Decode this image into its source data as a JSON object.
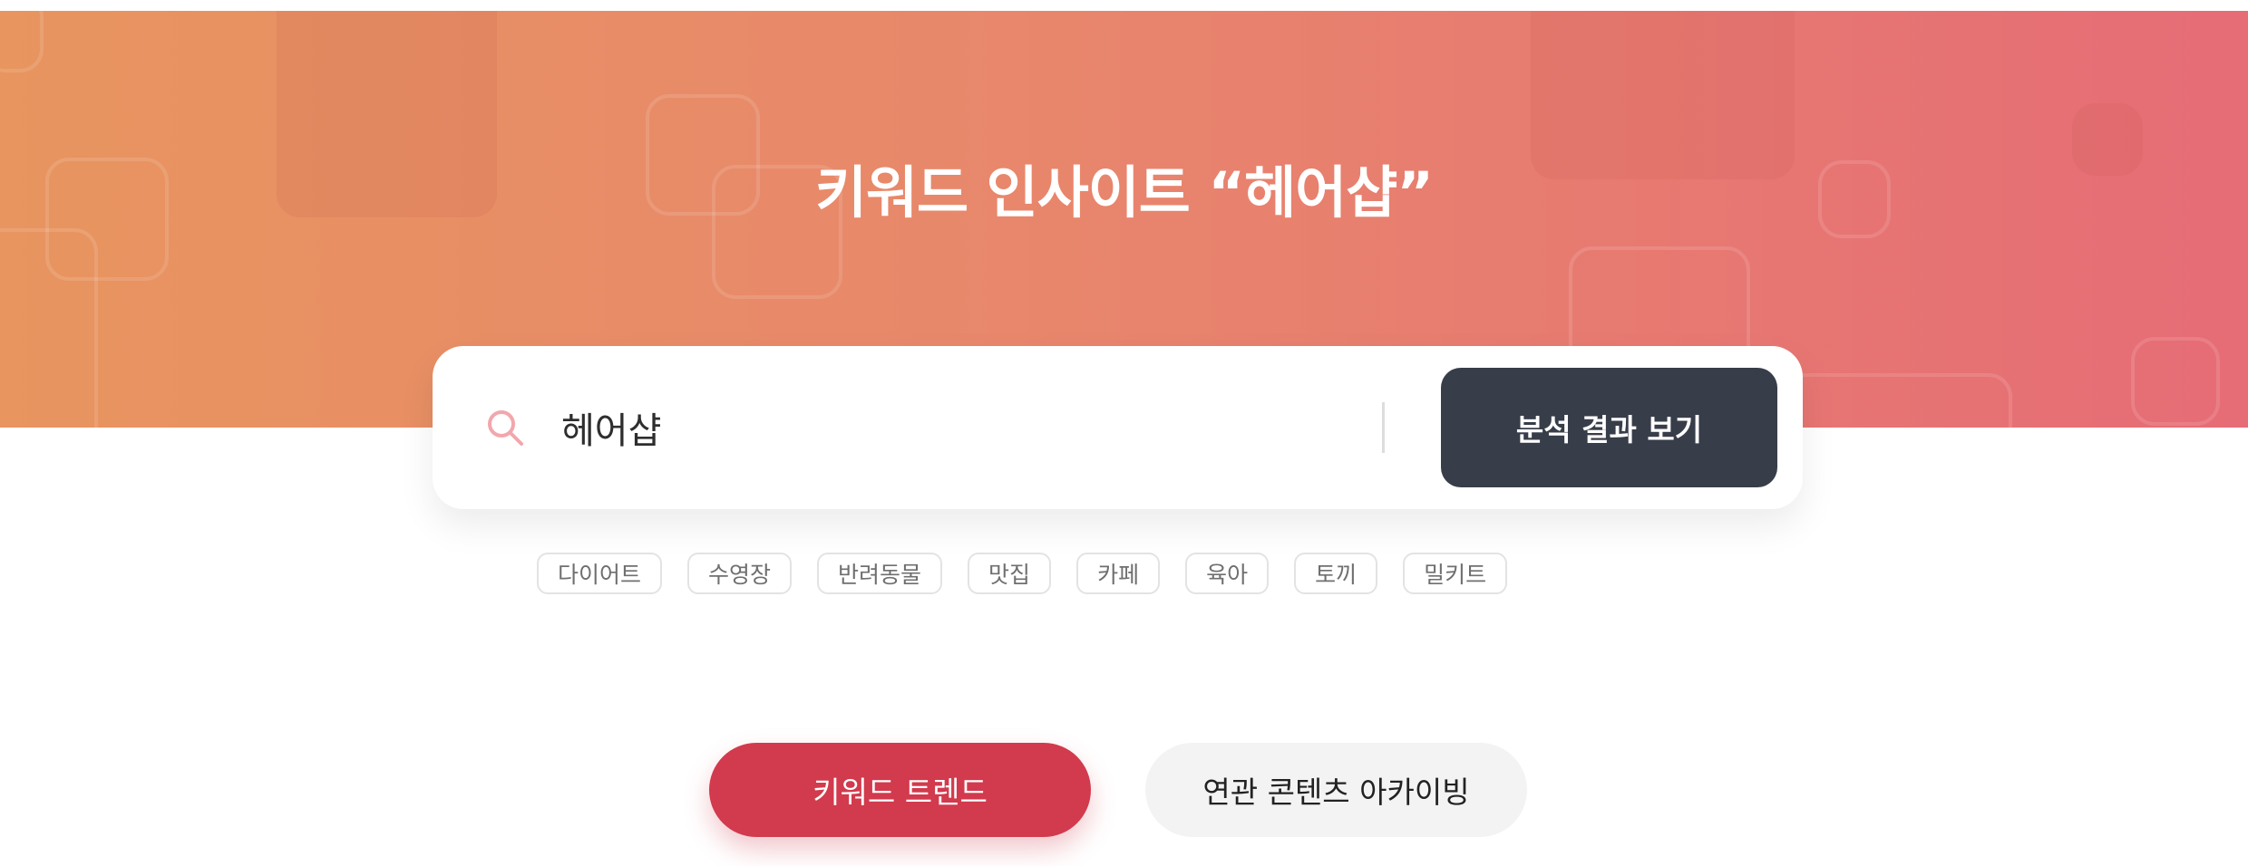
{
  "hero": {
    "title": "키워드 인사이트 “헤어샵”"
  },
  "search": {
    "value": "헤어샵",
    "submit_label": "분석 결과 보기",
    "icon": "search-icon"
  },
  "tags": [
    "다이어트",
    "수영장",
    "반려동물",
    "맛집",
    "카페",
    "육아",
    "토끼",
    "밀키트"
  ],
  "tabs": {
    "trend_label": "키워드 트렌드",
    "archive_label": "연관 콘텐츠 아카이빙"
  },
  "colors": {
    "hero_start": "#e8955f",
    "hero_end": "#e66c76",
    "button_dark": "#373d49",
    "accent_red": "#d23a4d",
    "icon_pink": "#f2a7ad"
  }
}
